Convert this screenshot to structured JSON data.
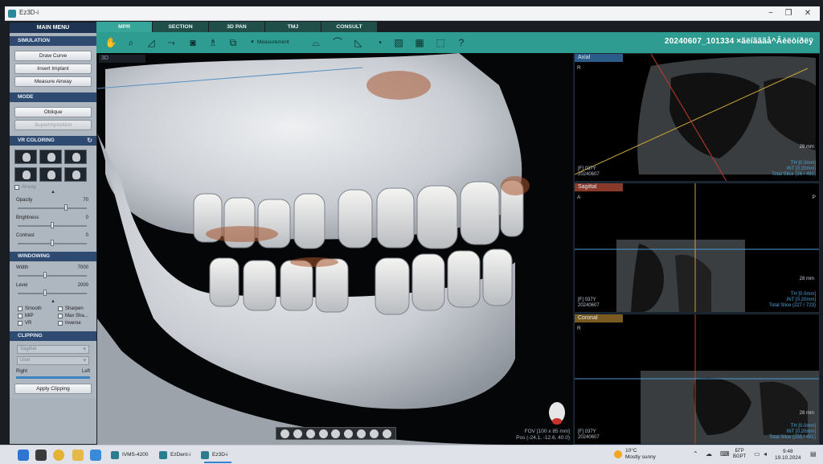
{
  "window": {
    "title": "Ez3D-i",
    "controls": {
      "minimize": "−",
      "maximize": "❐",
      "close": "✕"
    }
  },
  "tabs": [
    {
      "label": "MPR",
      "active": true
    },
    {
      "label": "SECTION",
      "active": false
    },
    {
      "label": "3D PAN",
      "active": false
    },
    {
      "label": "TMJ",
      "active": false
    },
    {
      "label": "CONSULT",
      "active": false
    }
  ],
  "toolbar": {
    "measurement_label": "Measurement",
    "case_id": "20240607_101334 ×ãëíãããå^Âèëòíðëÿ"
  },
  "left_panel": {
    "main_menu": "MAIN MENU",
    "simulation": {
      "header": "SIMULATION",
      "buttons": [
        "Draw Curve",
        "Insert Implant",
        "Measure Airway"
      ]
    },
    "mode": {
      "header": "MODE",
      "oblique": "Oblique",
      "superimposition": "Superimposition"
    },
    "vr_coloring": {
      "header": "VR COLORING",
      "airway": "Airway",
      "sliders": [
        {
          "label": "Opacity",
          "value": "70",
          "fraction": 0.7
        },
        {
          "label": "Brightness",
          "value": "0",
          "fraction": 0.5
        },
        {
          "label": "Contrast",
          "value": "0",
          "fraction": 0.5
        }
      ]
    },
    "windowing": {
      "header": "WINDOWING",
      "sliders": [
        {
          "label": "Width",
          "value": "7000",
          "fraction": 0.4
        },
        {
          "label": "Level",
          "value": "2000",
          "fraction": 0.4
        }
      ],
      "checks": [
        "Smooth",
        "Sharpen",
        "MIP",
        "Max Sha...",
        "VR",
        "Inverse"
      ]
    },
    "clipping": {
      "header": "CLIPPING",
      "select1": "Sagittal",
      "select2": "User",
      "right": "Right",
      "left": "Left",
      "apply": "Apply Clipping"
    }
  },
  "view3d": {
    "label": "3D",
    "fov_line1": "FOV [100 x 85 mm]",
    "fov_line2": "Pos (-24.1, -12.6, 40.0)"
  },
  "mpr": {
    "axial": {
      "title": "Axial",
      "orient_r": "R",
      "scale": "28 mm",
      "left1": "[F] 037Y",
      "left2": "20240607",
      "right1": "TH [0.0mm]",
      "right2": "INT [0.20mm]",
      "right3": "Total Slice (26 / 491)"
    },
    "sagittal": {
      "title": "Sagittal",
      "orient_a": "A",
      "orient_p": "P",
      "scale": "28 mm",
      "left1": "[F] 037Y",
      "left2": "20240607",
      "right1": "TH [0.0mm]",
      "right2": "INT [0.20mm]",
      "right3": "Total Slice (227 / 723)"
    },
    "coronal": {
      "title": "Coronal",
      "orient_r": "R",
      "scale": "28 mm",
      "left1": "[F] 037Y",
      "left2": "20240607",
      "right1": "TH [0.0mm]",
      "right2": "INT [0.20mm]",
      "right3": "Total Slice (255 / 491)"
    }
  },
  "taskbar": {
    "apps": [
      {
        "label": "IVMS-4200",
        "active": false
      },
      {
        "label": "EzDent-i",
        "active": false
      },
      {
        "label": "Ez3D-i",
        "active": true
      }
    ],
    "weather_temp": "10°C",
    "weather_desc": "Mostly sunny",
    "lang1": "БГР",
    "lang2": "BGPT",
    "time": "9:48",
    "date": "19.10.2024"
  },
  "colors": {
    "toolbar": "#2f9c92",
    "tab_active": "#37a69a",
    "tab_inactive": "#1f4f48",
    "panel_header": "#2f4a70",
    "axial_title": "#2c5d8a",
    "sagittal_title": "#8a3a2a",
    "coronal_title": "#7a5a20"
  }
}
